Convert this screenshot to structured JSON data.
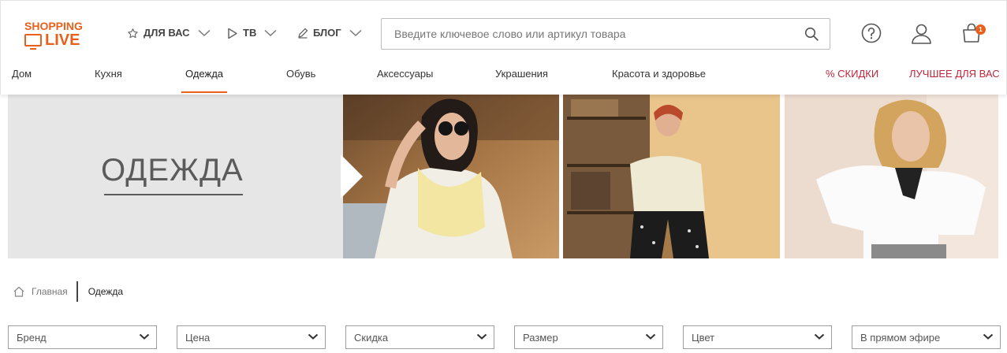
{
  "header": {
    "logo_line1": "SHOPPING",
    "logo_line2": "LIVE",
    "nav": [
      {
        "label": "ДЛЯ ВАС",
        "icon": "star-icon"
      },
      {
        "label": "ТВ",
        "icon": "play-icon"
      },
      {
        "label": "БЛОГ",
        "icon": "pencil-icon"
      }
    ],
    "search_placeholder": "Введите ключевое слово или артикул товара",
    "cart_count": "1",
    "icons": [
      "help-icon",
      "user-icon",
      "cart-icon"
    ]
  },
  "categories": [
    {
      "label": "Дом"
    },
    {
      "label": "Кухня"
    },
    {
      "label": "Одежда"
    },
    {
      "label": "Обувь"
    },
    {
      "label": "Аксессуары"
    },
    {
      "label": "Украшения"
    },
    {
      "label": "Красота и здоровье"
    },
    {
      "label": "% СКИДКИ"
    },
    {
      "label": "ЛУЧШЕЕ ДЛЯ ВАС"
    }
  ],
  "banner": {
    "title": "ОДЕЖДА"
  },
  "breadcrumb": {
    "home": "Главная",
    "current": "Одежда"
  },
  "filters": [
    {
      "label": "Бренд"
    },
    {
      "label": "Цена"
    },
    {
      "label": "Скидка"
    },
    {
      "label": "Размер"
    },
    {
      "label": "Цвет"
    },
    {
      "label": "В прямом эфире"
    }
  ],
  "colors": {
    "accent": "#e8601c",
    "sale": "#c0253a"
  }
}
